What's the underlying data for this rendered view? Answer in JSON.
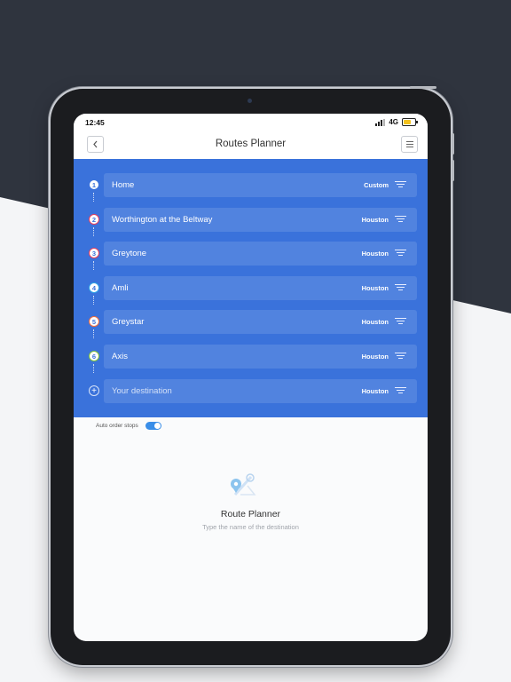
{
  "status_bar": {
    "time": "12:45",
    "network": "4G",
    "battery_level": 0.7
  },
  "header": {
    "title": "Routes Planner",
    "back_icon": "chevron-left-icon",
    "menu_icon": "hamburger-menu-icon"
  },
  "stops": [
    {
      "number": "1",
      "name": "Home",
      "city": "Custom",
      "ring_color": "#3a72db"
    },
    {
      "number": "2",
      "name": "Worthington at the Beltway",
      "city": "Houston",
      "ring_color": "#e83e5b"
    },
    {
      "number": "3",
      "name": "Greytone",
      "city": "Houston",
      "ring_color": "#e83e5b"
    },
    {
      "number": "4",
      "name": "Amli",
      "city": "Houston",
      "ring_color": "#2fa3e6"
    },
    {
      "number": "5",
      "name": "Greystar",
      "city": "Houston",
      "ring_color": "#f36b3a"
    },
    {
      "number": "6",
      "name": "Axis",
      "city": "Houston",
      "ring_color": "#7ec13b"
    }
  ],
  "destination": {
    "placeholder": "Your destination",
    "city": "Houston",
    "icon": "add-stop-icon"
  },
  "auto_order": {
    "label": "Auto order stops",
    "enabled": true
  },
  "empty_state": {
    "icon": "route-map-pin-icon",
    "title": "Route Planner",
    "subtitle": "Type the name of the destination"
  },
  "colors": {
    "accent": "#3a72db",
    "toggle": "#3a8ee8"
  }
}
